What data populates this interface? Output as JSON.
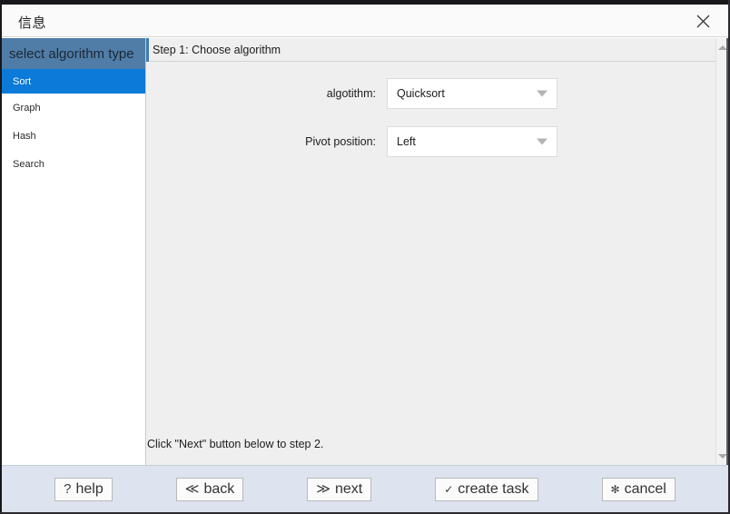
{
  "window": {
    "title": "信息",
    "close_icon": "close-icon"
  },
  "sidebar": {
    "header": "select algorithm type",
    "items": [
      {
        "label": "Sort",
        "selected": true
      },
      {
        "label": "Graph",
        "selected": false
      },
      {
        "label": "Hash",
        "selected": false
      },
      {
        "label": "Search",
        "selected": false
      }
    ]
  },
  "content": {
    "step_title": "Step 1: Choose algorithm",
    "fields": [
      {
        "label": "algotithm:",
        "value": "Quicksort"
      },
      {
        "label": "Pivot position:",
        "value": "Left"
      }
    ],
    "hint": "Click \"Next\" button below to step 2."
  },
  "scrollbar": {
    "up_icon": "triangle-up-icon",
    "down_icon": "triangle-down-icon"
  },
  "footer": {
    "buttons": [
      {
        "glyph": "?",
        "label": "help",
        "icon": "question-mark-icon"
      },
      {
        "glyph": "≪",
        "label": "back",
        "icon": "double-chevron-left-icon"
      },
      {
        "glyph": "≫",
        "label": "next",
        "icon": "double-chevron-right-icon"
      },
      {
        "glyph": "✓",
        "label": "create task",
        "icon": "check-icon"
      },
      {
        "glyph": "✻",
        "label": "cancel",
        "icon": "cancel-mark-icon"
      }
    ]
  },
  "colors": {
    "accent_blue": "#0b7ad8",
    "header_blue": "#4f7da8",
    "step_accent": "#3d7cb5",
    "footer_bg": "#dde3ef",
    "panel_bg": "#efefef"
  }
}
